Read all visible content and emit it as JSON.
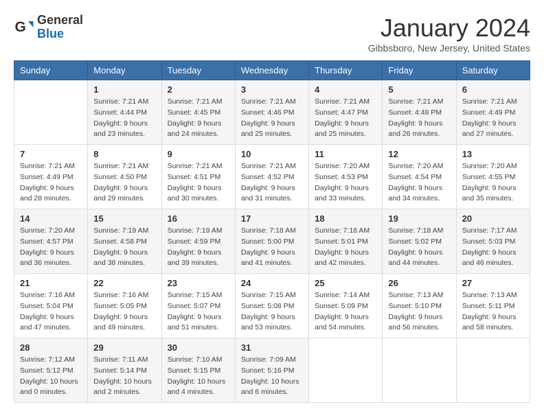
{
  "header": {
    "logo_general": "General",
    "logo_blue": "Blue",
    "month_title": "January 2024",
    "location": "Gibbsboro, New Jersey, United States"
  },
  "weekdays": [
    "Sunday",
    "Monday",
    "Tuesday",
    "Wednesday",
    "Thursday",
    "Friday",
    "Saturday"
  ],
  "weeks": [
    [
      {
        "day": "",
        "info": ""
      },
      {
        "day": "1",
        "info": "Sunrise: 7:21 AM\nSunset: 4:44 PM\nDaylight: 9 hours\nand 23 minutes."
      },
      {
        "day": "2",
        "info": "Sunrise: 7:21 AM\nSunset: 4:45 PM\nDaylight: 9 hours\nand 24 minutes."
      },
      {
        "day": "3",
        "info": "Sunrise: 7:21 AM\nSunset: 4:46 PM\nDaylight: 9 hours\nand 25 minutes."
      },
      {
        "day": "4",
        "info": "Sunrise: 7:21 AM\nSunset: 4:47 PM\nDaylight: 9 hours\nand 25 minutes."
      },
      {
        "day": "5",
        "info": "Sunrise: 7:21 AM\nSunset: 4:48 PM\nDaylight: 9 hours\nand 26 minutes."
      },
      {
        "day": "6",
        "info": "Sunrise: 7:21 AM\nSunset: 4:49 PM\nDaylight: 9 hours\nand 27 minutes."
      }
    ],
    [
      {
        "day": "7",
        "info": "Sunrise: 7:21 AM\nSunset: 4:49 PM\nDaylight: 9 hours\nand 28 minutes."
      },
      {
        "day": "8",
        "info": "Sunrise: 7:21 AM\nSunset: 4:50 PM\nDaylight: 9 hours\nand 29 minutes."
      },
      {
        "day": "9",
        "info": "Sunrise: 7:21 AM\nSunset: 4:51 PM\nDaylight: 9 hours\nand 30 minutes."
      },
      {
        "day": "10",
        "info": "Sunrise: 7:21 AM\nSunset: 4:52 PM\nDaylight: 9 hours\nand 31 minutes."
      },
      {
        "day": "11",
        "info": "Sunrise: 7:20 AM\nSunset: 4:53 PM\nDaylight: 9 hours\nand 33 minutes."
      },
      {
        "day": "12",
        "info": "Sunrise: 7:20 AM\nSunset: 4:54 PM\nDaylight: 9 hours\nand 34 minutes."
      },
      {
        "day": "13",
        "info": "Sunrise: 7:20 AM\nSunset: 4:55 PM\nDaylight: 9 hours\nand 35 minutes."
      }
    ],
    [
      {
        "day": "14",
        "info": "Sunrise: 7:20 AM\nSunset: 4:57 PM\nDaylight: 9 hours\nand 36 minutes."
      },
      {
        "day": "15",
        "info": "Sunrise: 7:19 AM\nSunset: 4:58 PM\nDaylight: 9 hours\nand 38 minutes."
      },
      {
        "day": "16",
        "info": "Sunrise: 7:19 AM\nSunset: 4:59 PM\nDaylight: 9 hours\nand 39 minutes."
      },
      {
        "day": "17",
        "info": "Sunrise: 7:18 AM\nSunset: 5:00 PM\nDaylight: 9 hours\nand 41 minutes."
      },
      {
        "day": "18",
        "info": "Sunrise: 7:18 AM\nSunset: 5:01 PM\nDaylight: 9 hours\nand 42 minutes."
      },
      {
        "day": "19",
        "info": "Sunrise: 7:18 AM\nSunset: 5:02 PM\nDaylight: 9 hours\nand 44 minutes."
      },
      {
        "day": "20",
        "info": "Sunrise: 7:17 AM\nSunset: 5:03 PM\nDaylight: 9 hours\nand 46 minutes."
      }
    ],
    [
      {
        "day": "21",
        "info": "Sunrise: 7:16 AM\nSunset: 5:04 PM\nDaylight: 9 hours\nand 47 minutes."
      },
      {
        "day": "22",
        "info": "Sunrise: 7:16 AM\nSunset: 5:05 PM\nDaylight: 9 hours\nand 49 minutes."
      },
      {
        "day": "23",
        "info": "Sunrise: 7:15 AM\nSunset: 5:07 PM\nDaylight: 9 hours\nand 51 minutes."
      },
      {
        "day": "24",
        "info": "Sunrise: 7:15 AM\nSunset: 5:08 PM\nDaylight: 9 hours\nand 53 minutes."
      },
      {
        "day": "25",
        "info": "Sunrise: 7:14 AM\nSunset: 5:09 PM\nDaylight: 9 hours\nand 54 minutes."
      },
      {
        "day": "26",
        "info": "Sunrise: 7:13 AM\nSunset: 5:10 PM\nDaylight: 9 hours\nand 56 minutes."
      },
      {
        "day": "27",
        "info": "Sunrise: 7:13 AM\nSunset: 5:11 PM\nDaylight: 9 hours\nand 58 minutes."
      }
    ],
    [
      {
        "day": "28",
        "info": "Sunrise: 7:12 AM\nSunset: 5:12 PM\nDaylight: 10 hours\nand 0 minutes."
      },
      {
        "day": "29",
        "info": "Sunrise: 7:11 AM\nSunset: 5:14 PM\nDaylight: 10 hours\nand 2 minutes."
      },
      {
        "day": "30",
        "info": "Sunrise: 7:10 AM\nSunset: 5:15 PM\nDaylight: 10 hours\nand 4 minutes."
      },
      {
        "day": "31",
        "info": "Sunrise: 7:09 AM\nSunset: 5:16 PM\nDaylight: 10 hours\nand 6 minutes."
      },
      {
        "day": "",
        "info": ""
      },
      {
        "day": "",
        "info": ""
      },
      {
        "day": "",
        "info": ""
      }
    ]
  ]
}
